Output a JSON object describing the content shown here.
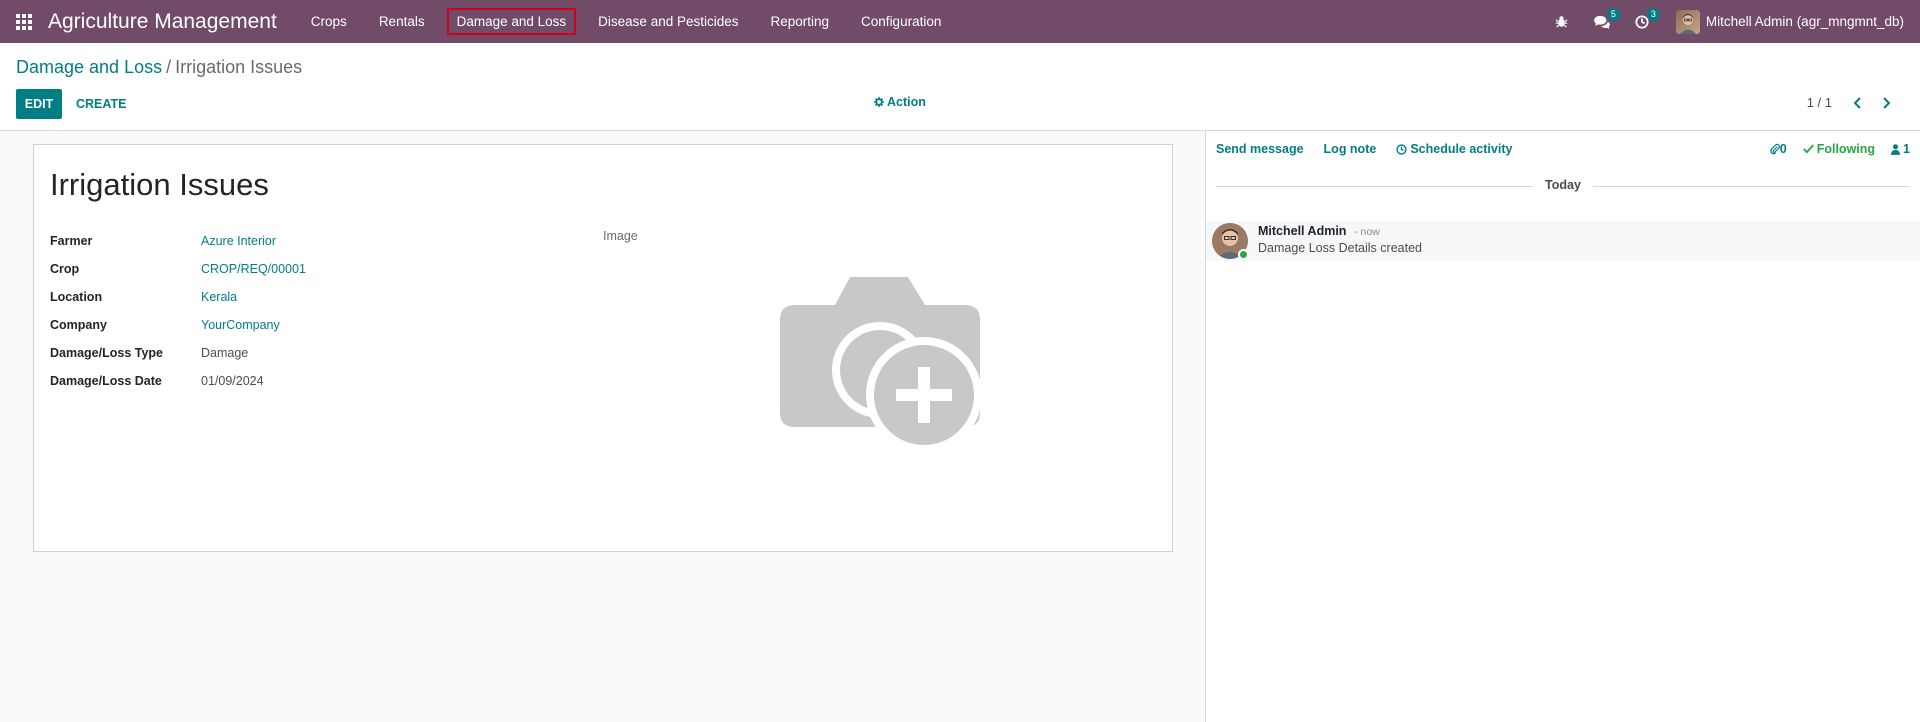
{
  "navbar": {
    "app_title": "Agriculture Management",
    "menu": [
      "Crops",
      "Rentals",
      "Damage and Loss",
      "Disease and Pesticides",
      "Reporting",
      "Configuration"
    ],
    "active_menu": "Damage and Loss",
    "messages_badge": "5",
    "activities_badge": "3",
    "user_name": "Mitchell Admin (agr_mngmnt_db)"
  },
  "control_panel": {
    "breadcrumb_parent": "Damage and Loss",
    "breadcrumb_current": "Irrigation Issues",
    "edit_label": "EDIT",
    "create_label": "CREATE",
    "action_label": "Action",
    "pager": "1 / 1"
  },
  "form": {
    "title": "Irrigation Issues",
    "fields": [
      {
        "label": "Farmer",
        "value": "Azure Interior",
        "link": true
      },
      {
        "label": "Crop",
        "value": "CROP/REQ/00001",
        "link": true
      },
      {
        "label": "Location",
        "value": "Kerala",
        "link": true
      },
      {
        "label": "Company",
        "value": "YourCompany",
        "link": true
      },
      {
        "label": "Damage/Loss Type",
        "value": "Damage",
        "link": false
      },
      {
        "label": "Damage/Loss Date",
        "value": "01/09/2024",
        "link": false
      }
    ],
    "image_label": "Image"
  },
  "chatter": {
    "send_message": "Send message",
    "log_note": "Log note",
    "schedule_activity": "Schedule activity",
    "attachments_count": "0",
    "following_label": "Following",
    "followers_count": "1",
    "today_label": "Today",
    "message": {
      "author": "Mitchell Admin",
      "time": "- now",
      "text": "Damage Loss Details created"
    }
  },
  "colors": {
    "navbar": "#714b67",
    "primary": "#017e84",
    "following": "#28a745"
  }
}
